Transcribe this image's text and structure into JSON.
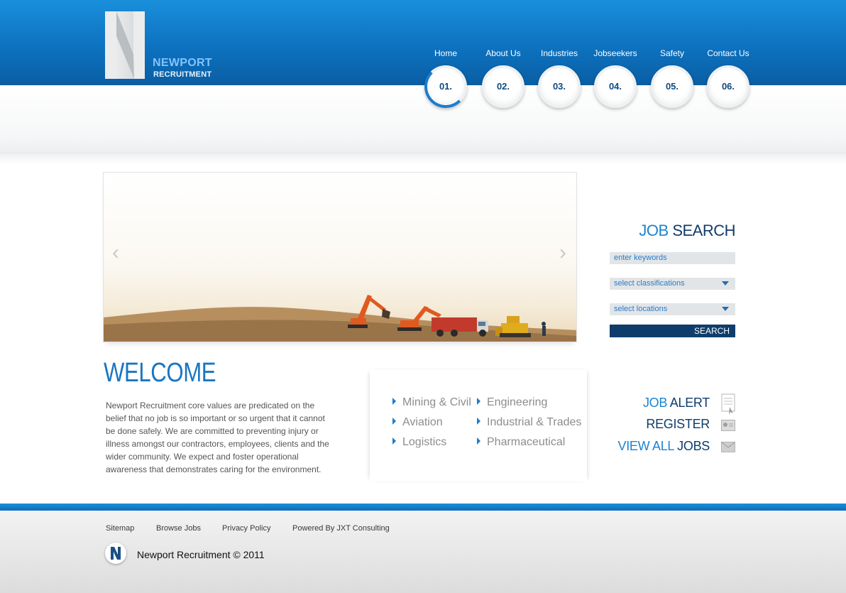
{
  "brand": {
    "logo_letter": "N",
    "word1": "NEWPORT",
    "word2": "RECRUITMENT",
    "primary_color": "#0d72c0",
    "dark_color": "#0f3d6b"
  },
  "nav": [
    {
      "label": "Home",
      "num": "01."
    },
    {
      "label": "About Us",
      "num": "02."
    },
    {
      "label": "Industries",
      "num": "03."
    },
    {
      "label": "Jobseekers",
      "num": "04."
    },
    {
      "label": "Safety",
      "num": "05."
    },
    {
      "label": "Contact Us",
      "num": "06."
    }
  ],
  "banner": {
    "prev": "‹",
    "next": "›"
  },
  "welcome": {
    "title": "WELCOME",
    "text": "Newport Recruitment core values are predicated on the belief that no job is so important or so urgent that it cannot be done safely. We are committed to preventing injury or illness amongst our contractors, employees, clients and the wider community. We expect and foster operational awareness that demonstrates caring for the environment."
  },
  "industries": [
    "Mining & Civil",
    "Aviation",
    "Logistics",
    "Engineering",
    "Industrial & Trades",
    "Pharmaceutical"
  ],
  "job_search": {
    "title_a": "JOB",
    "title_b": "SEARCH",
    "keywords_placeholder": "enter keywords",
    "classification": "select classifications",
    "location": "select locations",
    "button": "SEARCH"
  },
  "quick_links": [
    {
      "a": "JOB",
      "b": "ALERT",
      "icon": "document-icon"
    },
    {
      "a": "",
      "b": "REGISTER",
      "icon": "id-card-icon"
    },
    {
      "a": "VIEW ALL",
      "b": "JOBS",
      "icon": "envelope-icon"
    }
  ],
  "footer": {
    "links": [
      "Sitemap",
      "Browse Jobs",
      "Privacy Policy",
      "Powered By JXT Consulting"
    ],
    "copyright": "Newport Recruitment © 2011"
  }
}
